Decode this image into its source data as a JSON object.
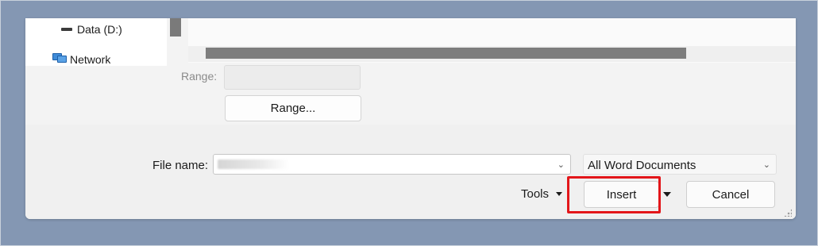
{
  "navigation": {
    "items": [
      {
        "label": "Data (D:)",
        "icon": "drive-icon"
      },
      {
        "label": "Network",
        "icon": "network-icon"
      }
    ]
  },
  "range": {
    "label": "Range:",
    "input_value": "",
    "button_label": "Range..."
  },
  "file_name": {
    "label": "File name:",
    "value": ""
  },
  "file_type": {
    "selected": "All Word Documents"
  },
  "actions": {
    "tools_label": "Tools",
    "insert_label": "Insert",
    "cancel_label": "Cancel"
  },
  "colors": {
    "frame": "#8497b3",
    "highlight": "#e3161a"
  }
}
